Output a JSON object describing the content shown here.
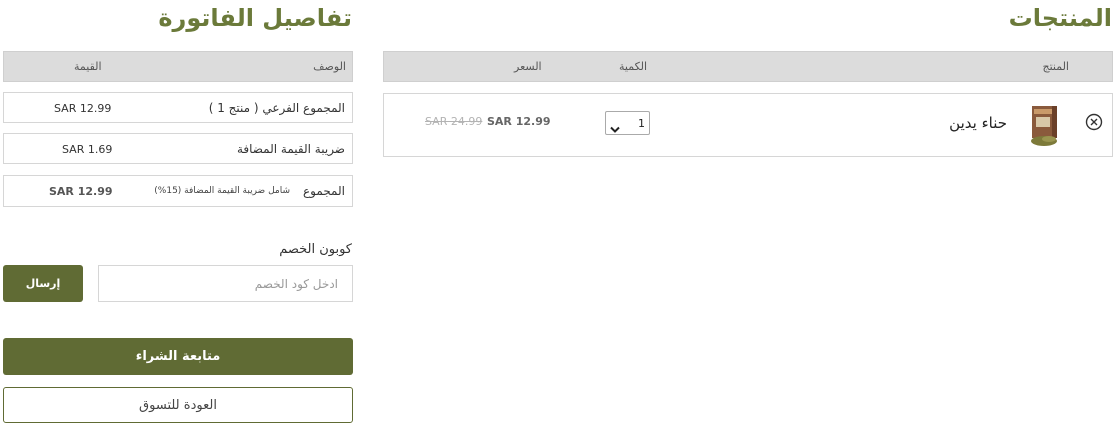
{
  "products": {
    "title": "المنتجات",
    "headers": {
      "product": "المنتج",
      "quantity": "الكمية",
      "price": "السعر"
    },
    "items": [
      {
        "name": "حناء يدين",
        "quantity": "1",
        "old_price": "SAR 24.99",
        "price": "SAR 12.99"
      }
    ]
  },
  "invoice": {
    "title": "تفاصيل الفاتورة",
    "headers": {
      "description": "الوصف",
      "value": "القيمة"
    },
    "rows": [
      {
        "label": "المجموع الفرعي ( منتج 1 )",
        "value": "SAR 12.99"
      },
      {
        "label": "ضريبة القيمة المضافة",
        "value": "SAR 1.69"
      }
    ],
    "total": {
      "label": "المجموع",
      "note": "شامل ضريبة القيمة المضافة (15%)",
      "value": "SAR 12.99"
    }
  },
  "coupon": {
    "title": "كوبون الخصم",
    "placeholder": "ادخل كود الخصم",
    "submit_label": "إرسال"
  },
  "actions": {
    "checkout_label": "متابعة الشراء",
    "back_label": "العودة للتسوق"
  },
  "colors": {
    "accent": "#606b34",
    "title": "#6b7a3a",
    "header_bg": "#dcdcdc"
  },
  "icons": {
    "remove": "close-circle-icon",
    "dropdown": "chevron-down-icon",
    "product_image": "henna-box-image"
  }
}
